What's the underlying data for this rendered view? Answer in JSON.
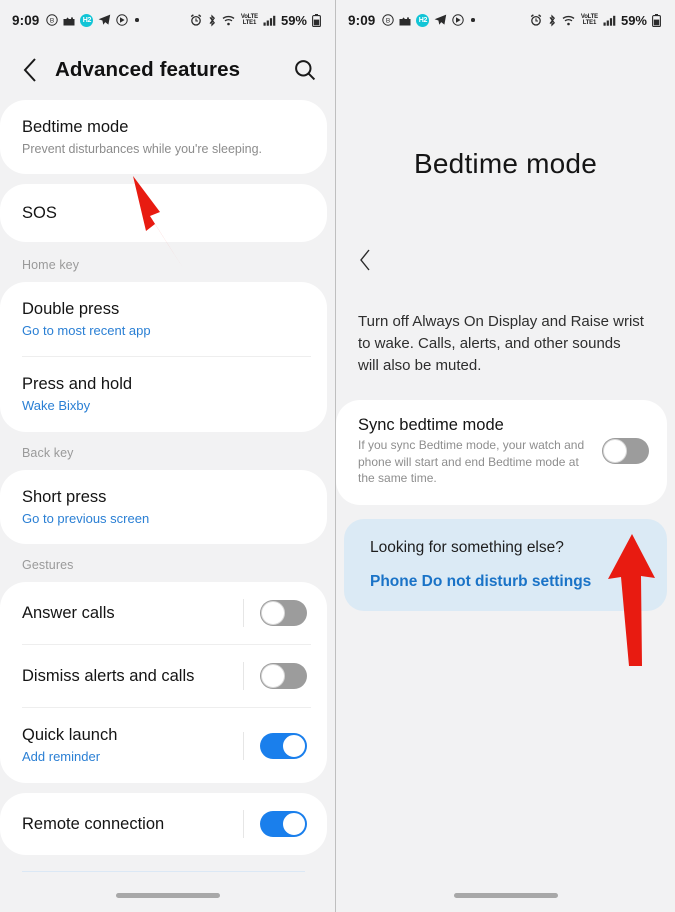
{
  "status_bar": {
    "time": "9:09",
    "battery_percent": "59%",
    "network_label_top": "VoLTE",
    "network_label_bottom": "LTE1",
    "badge_text": "H2",
    "left_icons": [
      "circled-b-icon",
      "image-upload-icon",
      "h2-badge-icon",
      "telegram-icon",
      "circled-arrow-icon",
      "dot-icon"
    ],
    "right_icons": [
      "alarm-icon",
      "bluetooth-icon",
      "wifi-icon",
      "volte-icon",
      "signal-bars-icon",
      "battery-icon"
    ]
  },
  "left_screen": {
    "header": {
      "title": "Advanced features",
      "back_icon": "back-chevron-icon",
      "search_icon": "search-icon"
    },
    "items": [
      {
        "title": "Bedtime mode",
        "subtitle": "Prevent disturbances while you're sleeping."
      },
      {
        "title": "SOS"
      }
    ],
    "sections": [
      {
        "label": "Home key",
        "rows": [
          {
            "title": "Double press",
            "link": "Go to most recent app"
          },
          {
            "title": "Press and hold",
            "link": "Wake Bixby"
          }
        ]
      },
      {
        "label": "Back key",
        "rows": [
          {
            "title": "Short press",
            "link": "Go to previous screen"
          }
        ]
      },
      {
        "label": "Gestures",
        "rows": [
          {
            "title": "Answer calls",
            "toggle": "off"
          },
          {
            "title": "Dismiss alerts and calls",
            "toggle": "off"
          },
          {
            "title": "Quick launch",
            "link": "Add reminder",
            "toggle": "on"
          }
        ]
      }
    ],
    "last_item": {
      "title": "Remote connection",
      "toggle": "on"
    }
  },
  "right_screen": {
    "title": "Bedtime mode",
    "back_icon": "back-chevron-icon",
    "description": "Turn off Always On Display and Raise wrist to wake. Calls, alerts, and other sounds will also be muted.",
    "sync": {
      "title": "Sync bedtime mode",
      "subtitle": "If you sync Bedtime mode, your watch and phone will start and end Bedtime mode at the same time.",
      "toggle": "off"
    },
    "info_card": {
      "question": "Looking for something else?",
      "link": "Phone Do not disturb settings"
    }
  },
  "annotations": {
    "arrow_color": "#e81b11",
    "left_arrow": "arrow-pointing-to-bedtime-mode",
    "right_arrow": "arrow-pointing-to-sync-toggle"
  },
  "colors": {
    "accent_blue": "#1a7fec",
    "link_blue": "#2a7fd4",
    "info_card_bg": "#dbeaf5",
    "background": "#f2f2f3",
    "card": "#ffffff"
  }
}
